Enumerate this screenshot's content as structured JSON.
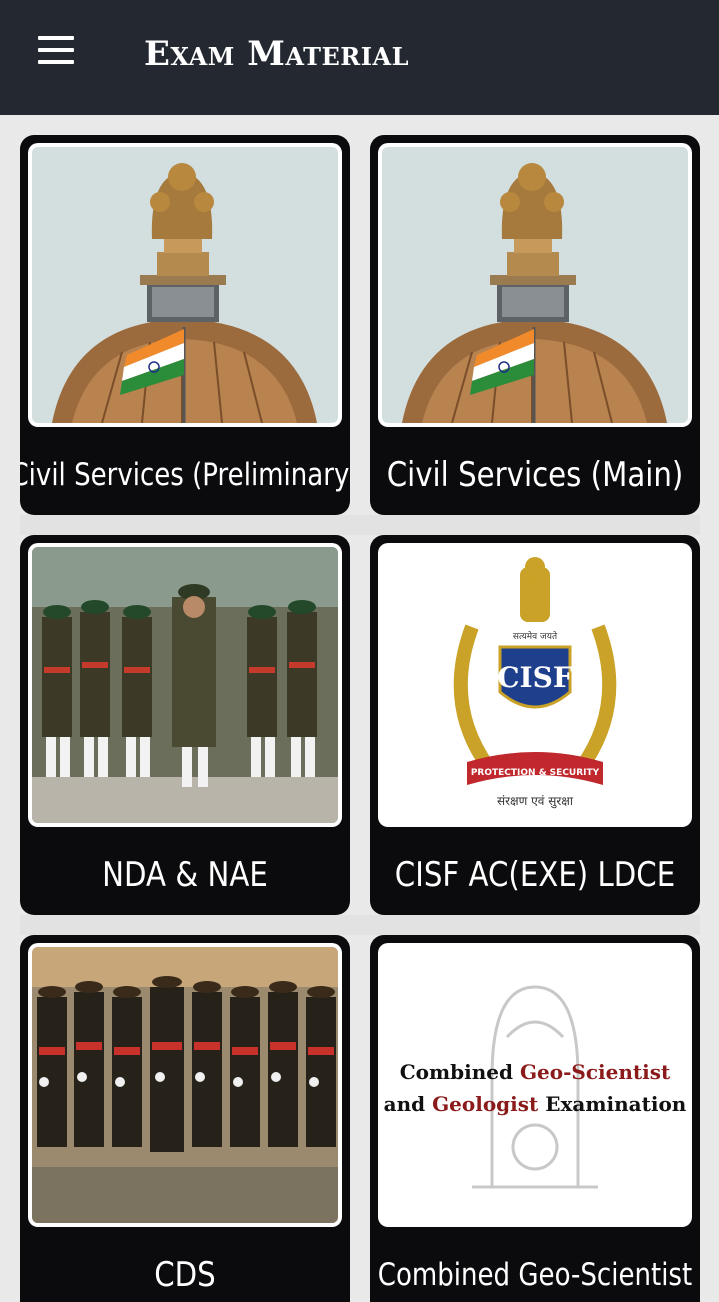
{
  "app_bar": {
    "title": "Exam Material",
    "menu_icon": "hamburger-menu-icon",
    "background": "#232831"
  },
  "cards": [
    {
      "label": "Civil Services (Preliminary)",
      "image": "emblem-dome-flag-image"
    },
    {
      "label": "Civil Services (Main)",
      "image": "emblem-dome-flag-image"
    },
    {
      "label": "NDA & NAE",
      "image": "army-parade-image"
    },
    {
      "label": "CISF AC(EXE) LDCE",
      "image": "cisf-logo-image"
    },
    {
      "label": "CDS",
      "image": "army-parade-image"
    },
    {
      "label": "Combined Geo-Scientist",
      "image": "geo-scientist-exam-image"
    }
  ],
  "cisf_logo": {
    "motto": "सत्यमेव जयते",
    "abbr": "CISF",
    "ribbon": "PROTECTION & SECURITY",
    "ribbon_hindi": "संरक्षण एवं सुरक्षा"
  },
  "geo_image": {
    "line1_a": "Combined ",
    "line1_b": "Geo-Scientist",
    "line2_a": "and ",
    "line2_b": "Geologist",
    "line2_c": " Examination"
  }
}
